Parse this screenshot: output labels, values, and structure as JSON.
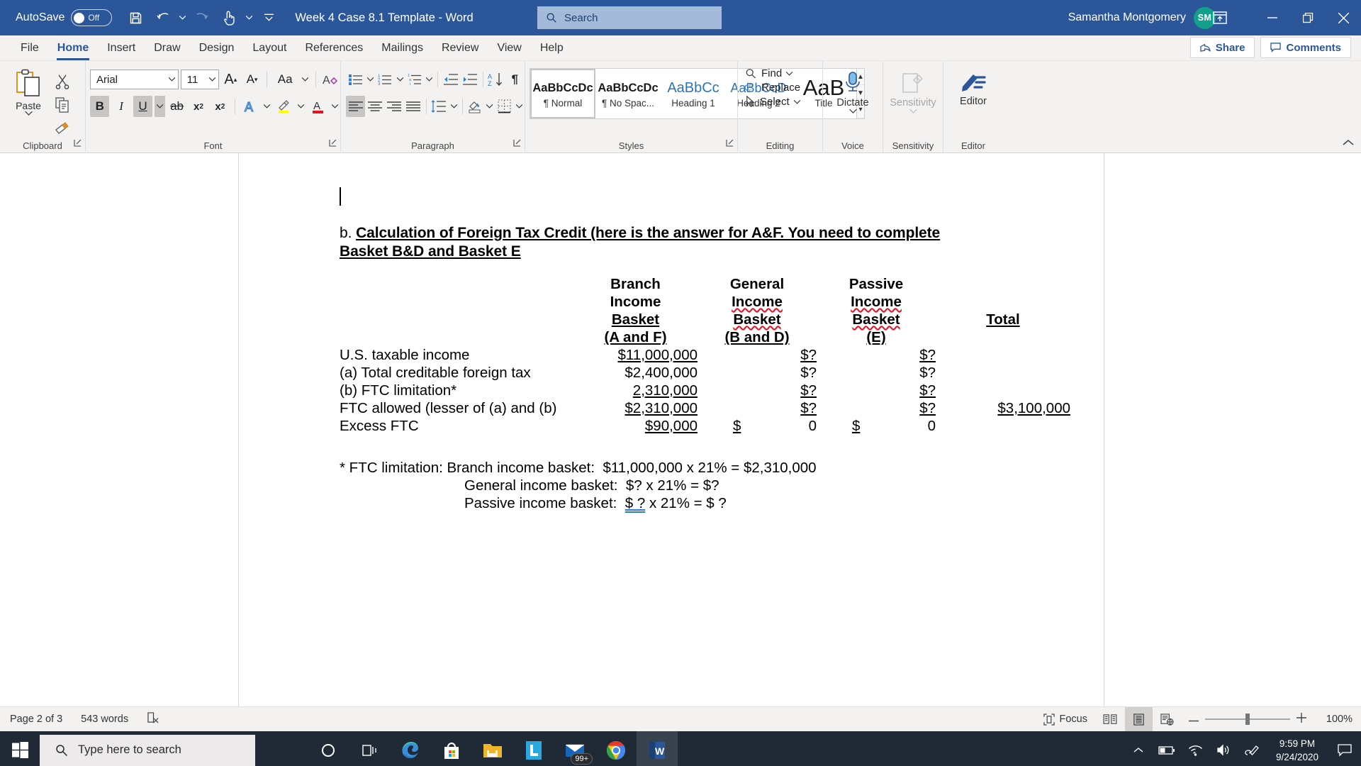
{
  "titlebar": {
    "autosave_label": "AutoSave",
    "autosave_state": "Off",
    "doc_title": "Week 4 Case 8.1 Template  -  Word",
    "search_placeholder": "Search",
    "user_name": "Samantha Montgomery",
    "user_initials": "SM",
    "accent": "#2b579a"
  },
  "tabs": [
    {
      "label": "File",
      "active": false
    },
    {
      "label": "Home",
      "active": true
    },
    {
      "label": "Insert",
      "active": false
    },
    {
      "label": "Draw",
      "active": false
    },
    {
      "label": "Design",
      "active": false
    },
    {
      "label": "Layout",
      "active": false
    },
    {
      "label": "References",
      "active": false
    },
    {
      "label": "Mailings",
      "active": false
    },
    {
      "label": "Review",
      "active": false
    },
    {
      "label": "View",
      "active": false
    },
    {
      "label": "Help",
      "active": false
    }
  ],
  "tabrow_right": {
    "share_label": "Share",
    "comments_label": "Comments"
  },
  "ribbon": {
    "clipboard": {
      "group_label": "Clipboard",
      "paste_label": "Paste"
    },
    "font": {
      "group_label": "Font",
      "font_name": "Arial",
      "font_size": "11",
      "bold_label": "B",
      "italic_label": "I",
      "underline_label": "U",
      "strike_label": "ab",
      "subscript_label": "x",
      "superscript_label": "x",
      "case_label": "Aa",
      "grow_label": "A",
      "shrink_label": "A",
      "text_color": "#e81123",
      "highlight_color": "#ffff00"
    },
    "paragraph": {
      "group_label": "Paragraph"
    },
    "styles": {
      "group_label": "Styles",
      "items": [
        {
          "preview": "AaBbCcDc",
          "name": "¶ Normal",
          "selected": true,
          "variant": "normal"
        },
        {
          "preview": "AaBbCcDc",
          "name": "¶ No Spac...",
          "selected": false,
          "variant": "normal"
        },
        {
          "preview": "AaBbCc",
          "name": "Heading 1",
          "selected": false,
          "variant": "blue"
        },
        {
          "preview": "AaBbCcD",
          "name": "Heading 2",
          "selected": false,
          "variant": "blue"
        },
        {
          "preview": "AaB",
          "name": "Title",
          "selected": false,
          "variant": "big"
        }
      ]
    },
    "editing": {
      "group_label": "Editing",
      "find_label": "Find",
      "replace_label": "Replace",
      "select_label": "Select"
    },
    "voice": {
      "group_label": "Voice",
      "dictate_label": "Dictate"
    },
    "sensitivity": {
      "group_label": "Sensitivity",
      "button_label": "Sensitivity",
      "disabled": true
    },
    "editor": {
      "group_label": "Editor",
      "button_label": "Editor"
    }
  },
  "document": {
    "heading_prefix": "b. ",
    "heading_text": "Calculation of Foreign Tax Credit (here is the answer for A&F. You need to complete Basket B&D and Basket E",
    "columns": [
      {
        "l1": "Branch",
        "l2": "Income",
        "l3": "Basket",
        "l4": "(A and F)",
        "misspelled": false
      },
      {
        "l1": "General",
        "l2": "Income",
        "l3": "Basket",
        "l4": "(B and D)",
        "misspelled": true
      },
      {
        "l1": "Passive",
        "l2": "Income",
        "l3": "Basket",
        "l4": "(E)",
        "misspelled": true
      },
      {
        "l1": "",
        "l2": "",
        "l3": "Total",
        "l4": "",
        "misspelled": false
      }
    ],
    "rows": [
      {
        "label": "U.S. taxable income",
        "branch": "$11,000,000",
        "general": "$?",
        "passive": "$?",
        "total": "",
        "underline": true
      },
      {
        "label": "(a) Total creditable foreign tax",
        "branch": "$2,400,000",
        "general": "$?",
        "passive": "$?",
        "total": "",
        "underline": false
      },
      {
        "label": "(b) FTC limitation*",
        "branch": "2,310,000",
        "general": "$?",
        "passive": "$?",
        "total": "",
        "underline": true
      },
      {
        "label": "FTC allowed (lesser of (a) and (b)",
        "branch": "$2,310,000",
        "general": "$?",
        "passive": "$?",
        "total": "$3,100,000",
        "underline": true
      },
      {
        "label": "Excess FTC",
        "branch": "$90,000",
        "general": "$|0",
        "passive": "$|0",
        "total": "",
        "underline": true
      }
    ],
    "footnote": {
      "line1_label": "* FTC limitation: Branch income basket:",
      "line1_value": "$11,000,000 x 21% = $2,310,000",
      "line2_label": "General income basket:",
      "line2_value": "$? x 21% = $?",
      "line3_label": "Passive income basket:",
      "line3_value_grammar": "$  ?",
      "line3_value_rest": " x 21% = $ ?"
    }
  },
  "statusbar": {
    "page_label": "Page 2 of 3",
    "word_count": "543 words",
    "focus_label": "Focus",
    "zoom_level": "100%"
  },
  "taskbar": {
    "search_placeholder": "Type here to search",
    "apps": [
      {
        "name": "cortana-icon",
        "badge": ""
      },
      {
        "name": "task-view-icon",
        "badge": ""
      },
      {
        "name": "edge-icon",
        "badge": ""
      },
      {
        "name": "microsoft-store-icon",
        "badge": ""
      },
      {
        "name": "file-explorer-icon",
        "badge": ""
      },
      {
        "name": "lockdown-browser-icon",
        "badge": ""
      },
      {
        "name": "mail-icon",
        "badge": "99+"
      },
      {
        "name": "chrome-icon",
        "badge": ""
      },
      {
        "name": "word-icon",
        "badge": ""
      }
    ],
    "time": "9:59 PM",
    "date": "9/24/2020"
  }
}
